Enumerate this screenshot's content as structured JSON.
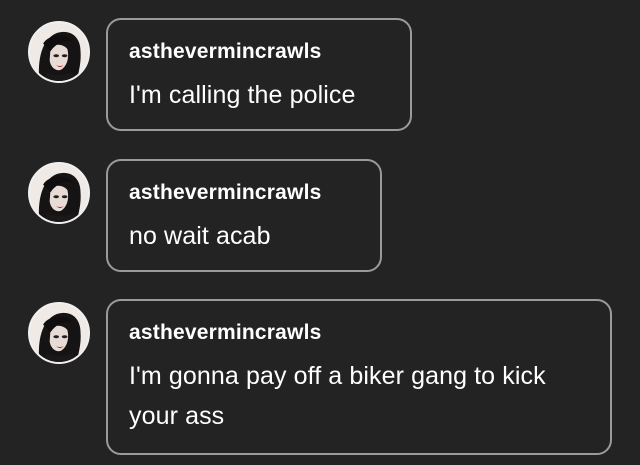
{
  "messages": [
    {
      "username": "asthevermincrawls",
      "avatar": "user-avatar-icon",
      "text": "I'm calling the police"
    },
    {
      "username": "asthevermincrawls",
      "avatar": "user-avatar-icon",
      "text": "no wait acab"
    },
    {
      "username": "asthevermincrawls",
      "avatar": "user-avatar-icon",
      "text": "I'm gonna pay off a biker gang to kick your ass"
    }
  ],
  "colors": {
    "background": "#232323",
    "bubble_border": "#9a9a9a",
    "text": "#ffffff"
  }
}
